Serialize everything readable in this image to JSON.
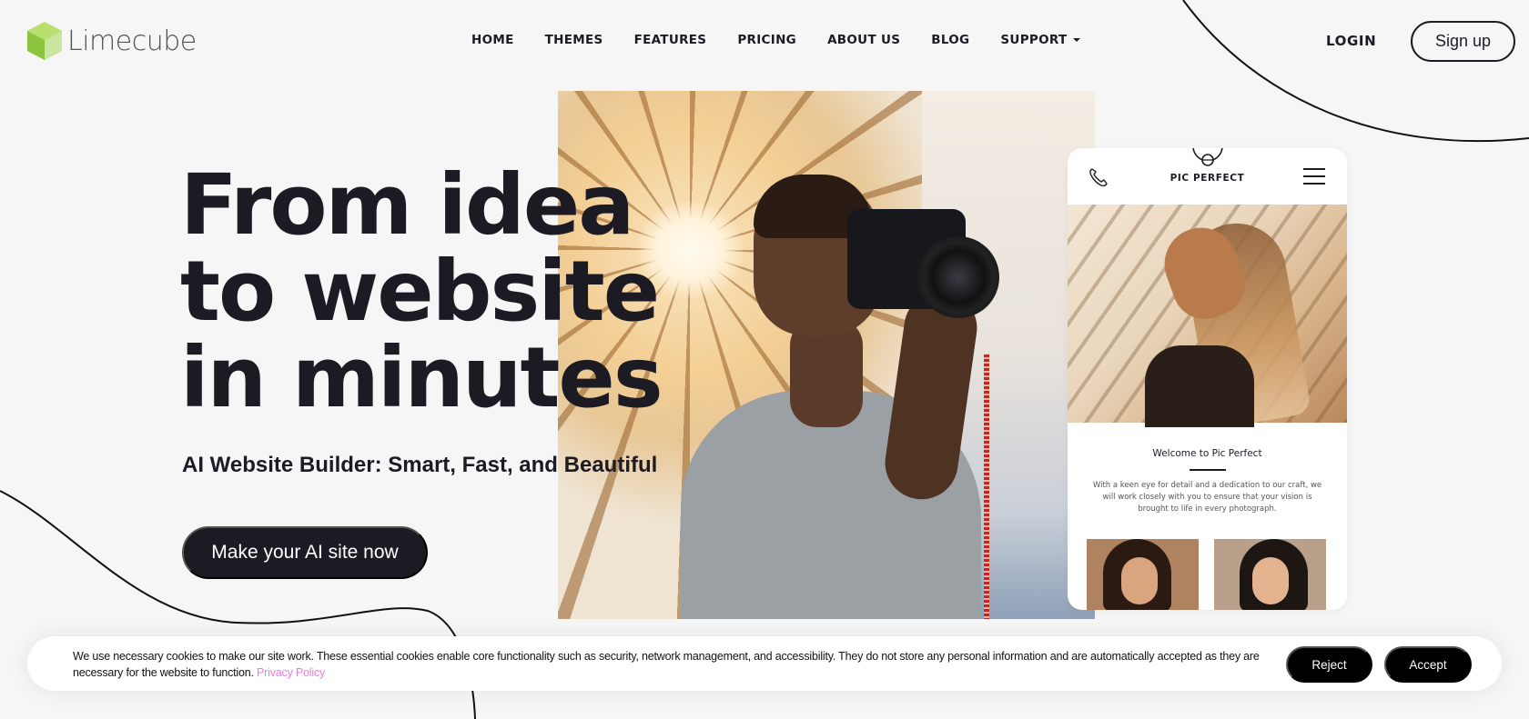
{
  "brand": {
    "name": "Limecube",
    "logo_color": "#9bd14a"
  },
  "nav": {
    "items": [
      {
        "label": "HOME"
      },
      {
        "label": "THEMES"
      },
      {
        "label": "FEATURES"
      },
      {
        "label": "PRICING"
      },
      {
        "label": "ABOUT US"
      },
      {
        "label": "BLOG"
      },
      {
        "label": "SUPPORT",
        "has_dropdown": true
      }
    ],
    "login_label": "LOGIN",
    "signup_label": "Sign up"
  },
  "hero": {
    "headline_lines": [
      "From idea",
      "to website",
      "in minutes"
    ],
    "subheadline": "AI Website Builder: Smart, Fast, and Beautiful",
    "cta_label": "Make your AI site now",
    "main_image": "photographer-with-camera"
  },
  "phone_mockup": {
    "brand": "PIC PERFECT",
    "phone_icon": "phone-icon",
    "menu_icon": "hamburger-menu-icon",
    "hero_image": "woman-in-sunlight-shadows",
    "welcome_title": "Welcome to Pic Perfect",
    "welcome_body": "With a keen eye for detail and a dedication to our craft, we will work closely with you to ensure that your vision is brought to life in every photograph.",
    "thumbnails": [
      "curly-hair-portrait",
      "woman-with-earrings-portrait"
    ]
  },
  "cookie_banner": {
    "text": "We use necessary cookies to make our site work. These essential cookies enable core functionality such as security, network management, and accessibility. They do not store any personal information and are automatically accepted as they are necessary for the website to function.",
    "privacy_link": "Privacy Policy",
    "privacy_color": "#e87ddd",
    "reject_label": "Reject",
    "accept_label": "Accept"
  },
  "colors": {
    "background": "#f6f6f6",
    "ink": "#1c1b24",
    "button_black": "#000000"
  }
}
